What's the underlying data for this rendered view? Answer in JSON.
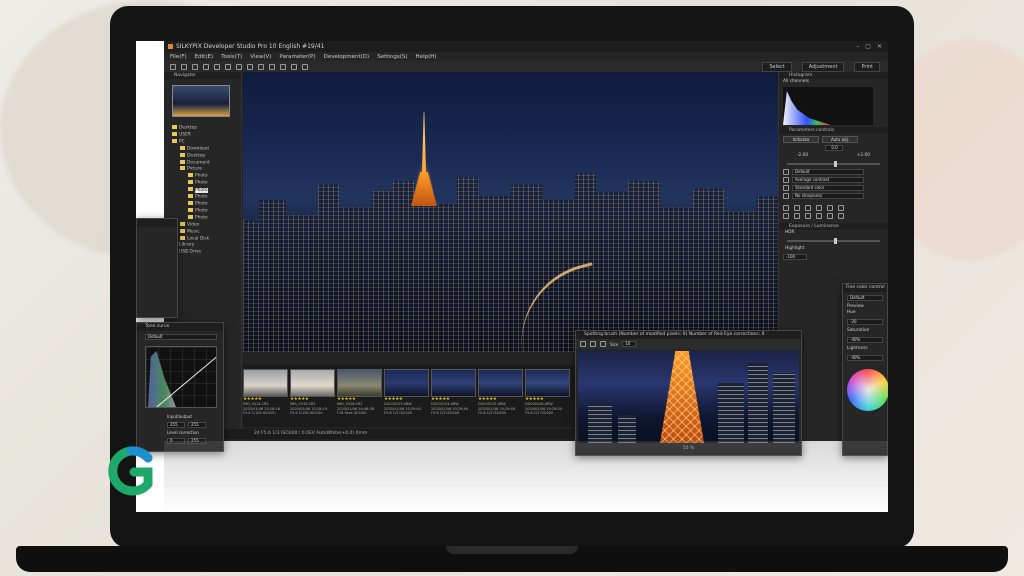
{
  "app": {
    "title": "SILKYPIX Developer Studio Pro 10 English   #19/41",
    "menu": [
      "File(F)",
      "Edit(E)",
      "Tools(T)",
      "View(V)",
      "Parameter(P)",
      "Development(D)",
      "Settings(S)",
      "Help(H)"
    ],
    "toolbar_right": [
      "Select",
      "Adjustment",
      "Print"
    ]
  },
  "left_panel": {
    "navigator_title": "Navigator",
    "tree": [
      {
        "label": "Desktop",
        "level": 0
      },
      {
        "label": "USER",
        "level": 0
      },
      {
        "label": "PC",
        "level": 0
      },
      {
        "label": "Download",
        "level": 1
      },
      {
        "label": "Desktop",
        "level": 1
      },
      {
        "label": "Document",
        "level": 1
      },
      {
        "label": "Picture",
        "level": 1
      },
      {
        "label": "Photo",
        "level": 2
      },
      {
        "label": "Photo",
        "level": 2
      },
      {
        "label": "Photo",
        "level": 2,
        "selected": true
      },
      {
        "label": "Photo",
        "level": 2
      },
      {
        "label": "Photo",
        "level": 2
      },
      {
        "label": "Photo",
        "level": 2
      },
      {
        "label": "Photo",
        "level": 2
      },
      {
        "label": "Video",
        "level": 1
      },
      {
        "label": "Music",
        "level": 1
      },
      {
        "label": "Local Disk",
        "level": 1
      },
      {
        "label": "Library",
        "level": 0
      },
      {
        "label": "USB Drive",
        "level": 0
      }
    ]
  },
  "filmstrip": [
    {
      "name": "IMG_9414.CR2",
      "date": "2020/01/06 15:28:18",
      "info": "F5.6 1/100 ISO200",
      "stars": "★★★★★"
    },
    {
      "name": "IMG_9415.CR2",
      "date": "2020/01/06 15:28:19",
      "info": "F5.6 1/100 ISO200",
      "stars": "★★★★★"
    },
    {
      "name": "IMG_9416.CR2",
      "date": "2020/01/06 16:48:38",
      "info": "F18 5sec ISO100",
      "stars": "★★★★★"
    },
    {
      "name": "DSC00123.ARW",
      "date": "2020/01/06 19:29:44",
      "info": "F5.6 1/3 ISO200",
      "stars": "★★★★★"
    },
    {
      "name": "DSC00124.ARW",
      "date": "2020/01/06 19:29:46",
      "info": "F5.6 1/3 ISO200",
      "stars": "★★★★★"
    },
    {
      "name": "DSC00125.ARW",
      "date": "2020/01/06 19:29:48",
      "info": "F5.6 1/3 ISO200",
      "stars": "★★★★★"
    },
    {
      "name": "DSC00126.ARW",
      "date": "2020/01/06 19:29:50",
      "info": "F5.6 1/3 ISO200",
      "stars": "★★★★★"
    }
  ],
  "status_bar": "24 F5.6 1/3 ISO200 / 0.0EV AutoWhite(+0.0) 0mm",
  "right_panel": {
    "histogram_title": "Histogram",
    "channels": "All channels",
    "params_title": "Parameters controls",
    "initialize": "Initialize",
    "auto_adj": "Auto adj.",
    "exposure_val": "0.0",
    "ev_min": "-2.00",
    "ev_max": "+2.00",
    "rows": [
      "Default",
      "Average contrast",
      "Standard color",
      "No sharpness"
    ],
    "exposure_title": "Exposure / Luminance",
    "hdr_label": "HDR",
    "highlight_label": "Highlight",
    "highlight_val": "-100"
  },
  "tone_panel": {
    "title": "Tone curve",
    "preset": "Default",
    "input_label": "Input/output",
    "input_val": "255",
    "output_val": "255",
    "level_label": "Level correction",
    "level_lo": "0",
    "level_hi": "255"
  },
  "spot_panel": {
    "title": "Spotting brush (Number of modified pixels: 0) Number of Red Eye corrections: 0",
    "size_label": "Size",
    "size_val": "10",
    "zoom": "50 %"
  },
  "color_panel": {
    "title": "Fine color control",
    "preset": "Default",
    "preview": "Preview",
    "hue_label": "Hue",
    "hue_val": "-20",
    "saturation_label": "Saturation",
    "saturation_val": "-40%",
    "lightness_label": "Lightness",
    "lightness_val": "-40%"
  }
}
